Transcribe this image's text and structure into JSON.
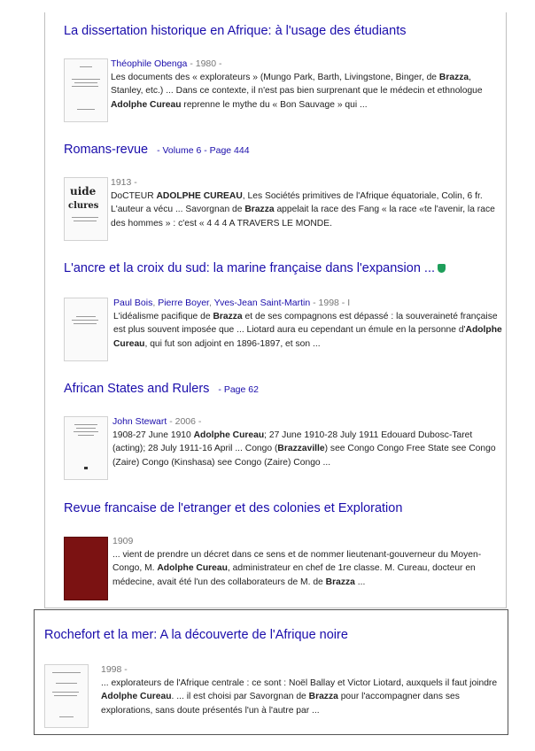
{
  "results": [
    {
      "title": "La dissertation historique en Afrique: à l'usage des étudiants",
      "page_ref": "",
      "authors": [
        "Théophile Obenga"
      ],
      "meta": " - 1980 -",
      "snippet": "Les documents des « explorateurs » (Mungo Park, Barth, Livingstone, Binger, de <b>Brazza</b>, Stanley, etc.) ... Dans ce contexte, il n'est pas bien surprenant que le médecin et ethnologue <b>Adolphe Cureau</b> reprenne le mythe du « Bon Sauvage » qui ..."
    },
    {
      "title": "Romans-revue",
      "page_ref": "- Volume 6 - Page 444",
      "authors": [],
      "meta": "1913 -",
      "snippet": "DoCTEUR <b>ADOLPHE CUREAU</b>, Les Sociétés primitives de l'Afrique équatoriale, Colin, 6 fr. L'auteur a vécu ... Savorgnan de <b>Brazza</b> appelait la race des Fang « la race «te l'avenir, la race des hommes » : c'est « 4 4 4 A TRAVERS LE MONDE."
    },
    {
      "title": "L'ancre et la croix du sud: la marine française dans l'expansion ...",
      "page_ref": "",
      "authors": [
        "Paul Bois",
        "Pierre Boyer",
        "Yves-Jean Saint-Martin"
      ],
      "meta": " - 1998 - I",
      "snippet": "L'idéalisme pacifique de <b>Brazza</b> et de ses compagnons est dépassé : la souveraineté française est plus souvent imposée que ... Liotard aura eu cependant un émule en la personne d'<b>Adolphe Cureau</b>, qui fut son adjoint en 1896-1897, et son ..."
    },
    {
      "title": "African States and Rulers",
      "page_ref": "- Page 62",
      "authors": [
        "John Stewart"
      ],
      "meta": " - 2006 -",
      "snippet": "1908-27 June 1910 <b>Adolphe Cureau</b>; 27 June 1910-28 July 1911 Edouard Dubosc-Taret (acting); 28 July 1911-16 April ... Congo (<b>Brazzaville</b>) see Congo Congo Free State see Congo (Zaire) Congo (Kinshasa) see Congo (Zaire) Congo ..."
    },
    {
      "title": "Revue francaise de l'etranger et des colonies et Exploration",
      "page_ref": "",
      "authors": [],
      "meta": "1909",
      "snippet": "... vient de prendre un décret dans ce sens et de nommer lieutenant-gouverneur du Moyen-Congo, M. <b>Adolphe Cureau</b>, administrateur en chef de 1re classe. M. Cureau, docteur en médecine, avait été l'un des collaborateurs de M. de <b>Brazza</b> ..."
    },
    {
      "title": "Rochefort et la mer: A la découverte de l'Afrique noire",
      "page_ref": "",
      "authors": [],
      "meta": "1998 -",
      "snippet": "... explorateurs de l'Afrique centrale : ce sont : Noël Ballay et Victor Liotard, auxquels il faut joindre <b>Adolphe Cureau</b>. ... il est choisi par Savorgnan de <b>Brazza</b> pour l'accompagner dans ses explorations, sans doute présentés l'un à l'autre par ..."
    }
  ],
  "thumb_text": {
    "r2_line1": "uide",
    "r2_line2": "clures"
  },
  "colors": {
    "link": "#1a0dab",
    "shield": "#1e9e5a",
    "cover_red": "#7b1212"
  }
}
